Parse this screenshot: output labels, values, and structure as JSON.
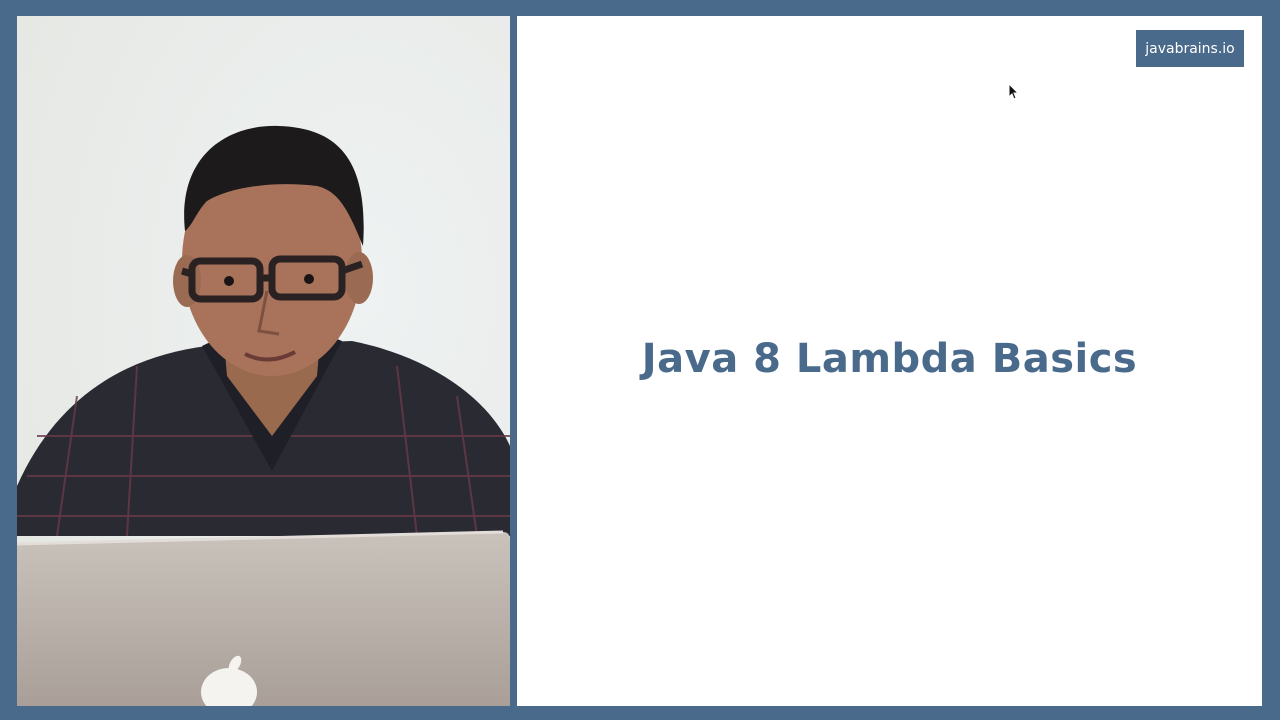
{
  "slide": {
    "title": "Java 8 Lambda Basics"
  },
  "brand": {
    "label": "javabrains.io"
  },
  "colors": {
    "frame": "#4a6a8c",
    "title": "#4a6a8c",
    "badge_bg": "#4a6a8c"
  },
  "icons": {
    "laptop_logo": "apple-logo-icon",
    "pointer": "mouse-cursor-icon"
  }
}
